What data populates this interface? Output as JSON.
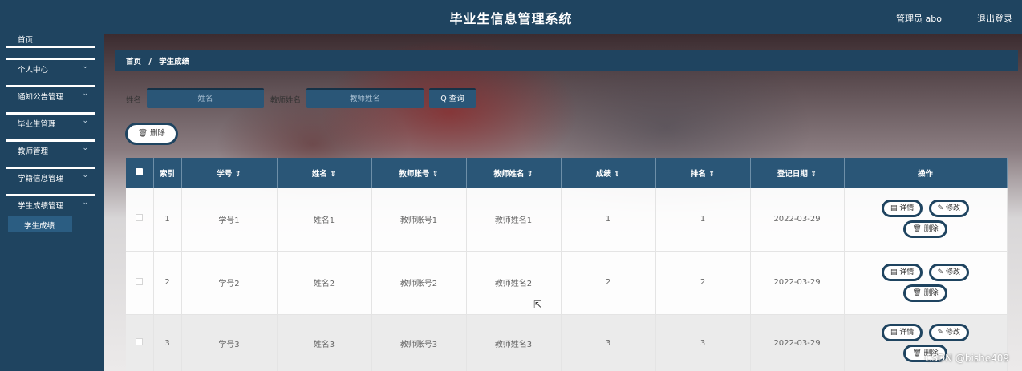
{
  "header": {
    "title": "毕业生信息管理系统",
    "user": "管理员 abo",
    "logout": "退出登录"
  },
  "sidebar": {
    "partial_top": "首页",
    "items": [
      {
        "label": "个人中心"
      },
      {
        "label": "通知公告管理"
      },
      {
        "label": "毕业生管理"
      },
      {
        "label": "教师管理"
      },
      {
        "label": "学籍信息管理"
      },
      {
        "label": "学生成绩管理"
      }
    ],
    "chevron": "⌄",
    "active_sub": "学生成绩"
  },
  "breadcrumb": {
    "home": "首页",
    "sep": "/",
    "current": "学生成绩"
  },
  "search": {
    "name_label": "姓名",
    "name_placeholder": "姓名",
    "teacher_label": "教师姓名",
    "teacher_placeholder": "教师姓名",
    "query_icon": "Q",
    "query_label": "查询"
  },
  "toolbar": {
    "delete_icon": "🗑",
    "delete_label": "删除"
  },
  "table": {
    "headers": {
      "index": "索引",
      "student_no": "学号 ⇕",
      "name": "姓名 ⇕",
      "teacher_account": "教师账号 ⇕",
      "teacher_name": "教师姓名 ⇕",
      "score": "成绩 ⇕",
      "rank": "排名 ⇕",
      "date": "登记日期 ⇕",
      "actions": "操作"
    },
    "rows": [
      {
        "index": "1",
        "student_no": "学号1",
        "name": "姓名1",
        "teacher_account": "教师账号1",
        "teacher_name": "教师姓名1",
        "score": "1",
        "rank": "1",
        "date": "2022-03-29"
      },
      {
        "index": "2",
        "student_no": "学号2",
        "name": "姓名2",
        "teacher_account": "教师账号2",
        "teacher_name": "教师姓名2",
        "score": "2",
        "rank": "2",
        "date": "2022-03-29"
      },
      {
        "index": "3",
        "student_no": "学号3",
        "name": "姓名3",
        "teacher_account": "教师账号3",
        "teacher_name": "教师姓名3",
        "score": "3",
        "rank": "3",
        "date": "2022-03-29"
      }
    ],
    "actions": {
      "detail": "▤ 详情",
      "edit": "✎ 修改",
      "delete": "🗑 删除"
    }
  },
  "watermark": "CSDN @bishe409"
}
